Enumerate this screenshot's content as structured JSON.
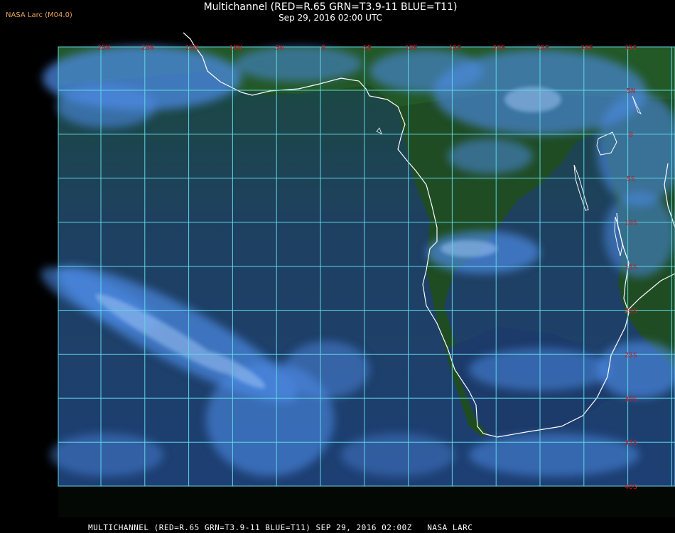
{
  "header": {
    "title": "Multichannel (RED=R.65 GRN=T3.9-11 BLUE=T11)",
    "subtitle": "Sep 29, 2016 02:00 UTC",
    "corner_label": "NASA Larc (M04.0)"
  },
  "footer": {
    "caption": "MULTICHANNEL (RED=R.65 GRN=T3.9-11 BLUE=T11) SEP 29, 2016 02:00Z   NASA LARC"
  },
  "map": {
    "longitude_labels": [
      "25W",
      "20W",
      "15W",
      "10W",
      "5W",
      "0",
      "5E",
      "10E",
      "15E",
      "20E",
      "25E",
      "30E",
      "35E"
    ],
    "latitude_labels": [
      "5N",
      "0",
      "5S",
      "10S",
      "15S",
      "20S",
      "25S",
      "30S",
      "35S",
      "40S"
    ],
    "colors": {
      "grid": "#5fd6e4",
      "coast": "#ffffff",
      "label": "#c21c28",
      "ocean": "#1c3f6e",
      "land": "#1e4a22",
      "cloud": "#4a86e0"
    }
  }
}
